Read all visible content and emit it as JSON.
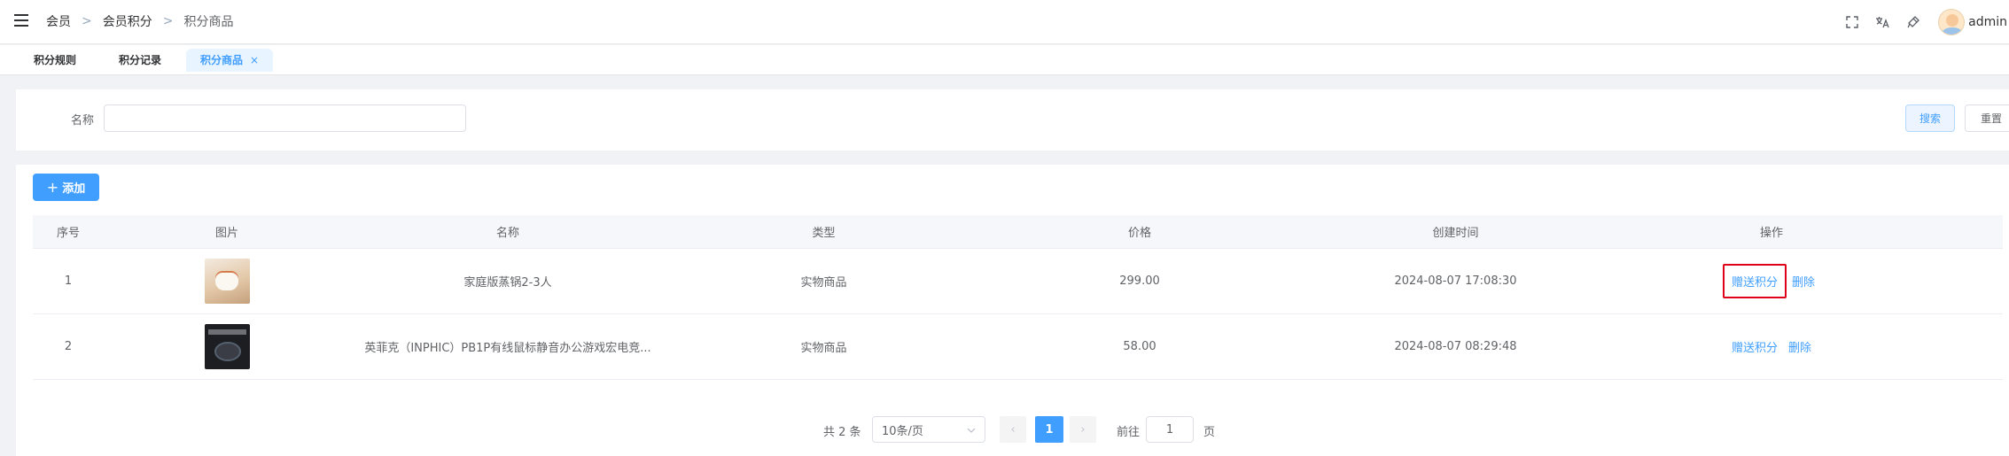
{
  "breadcrumb": [
    "会员",
    "会员积分",
    "积分商品"
  ],
  "breadcrumb_sep": ">",
  "header": {
    "username": "admin"
  },
  "icons": [
    "menu-icon",
    "fullscreen-icon",
    "translate-icon",
    "theme-icon",
    "avatar"
  ],
  "tags": [
    {
      "label": "积分规则"
    },
    {
      "label": "积分记录"
    },
    {
      "label": "积分商品",
      "close": "×",
      "active": true
    }
  ],
  "search": {
    "label": "名称",
    "value": "",
    "search_button": "搜索",
    "reset_button": "重置"
  },
  "toolbar": {
    "add_icon": "+",
    "add_label": "添加"
  },
  "table": {
    "headers": [
      "序号",
      "图片",
      "名称",
      "类型",
      "价格",
      "创建时间",
      "操作"
    ],
    "rows": [
      {
        "index": "1",
        "image": "steamer-product-image",
        "name": "家庭版蒸锅2-3人",
        "type": "实物商品",
        "price": "299.00",
        "created": "2024-08-07 17:08:30",
        "action_gift": "赠送积分",
        "action_delete": "删除"
      },
      {
        "index": "2",
        "image": "mouse-product-image",
        "name": "英菲克（INPHIC）PB1P有线鼠标静音办公游戏宏电竞...",
        "type": "实物商品",
        "price": "58.00",
        "created": "2024-08-07 08:29:48",
        "action_gift": "赠送积分",
        "action_delete": "删除"
      }
    ]
  },
  "pagination": {
    "total": "共 2 条",
    "page_size": "10条/页",
    "prev": "‹",
    "current": "1",
    "next": "›",
    "goto_label": "前往",
    "goto_value": "1",
    "page_suffix": "页"
  },
  "colors": {
    "primary": "#409eff",
    "highlight_border": "#e0001a"
  }
}
